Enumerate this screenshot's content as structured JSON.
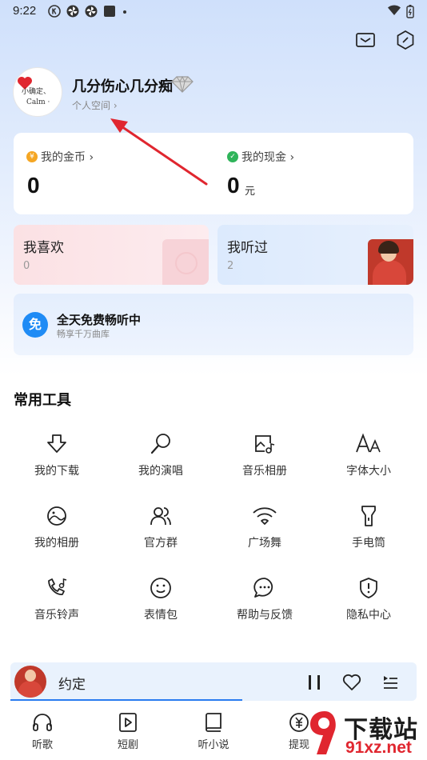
{
  "status_bar": {
    "time": "9:22",
    "left_icons": [
      "k-circle-icon",
      "pinwheel-icon",
      "pinwheel-icon",
      "square-icon",
      "dot-icon"
    ],
    "right_icons": [
      "wifi-icon",
      "battery-icon"
    ]
  },
  "header": {
    "icons": [
      "mail-icon",
      "hexagon-settings-icon"
    ]
  },
  "profile": {
    "username": "几分伤心几分痴",
    "space_link": "个人空间 ›",
    "avatar_text_line1": "小确定、",
    "avatar_text_line2": "Calm ·",
    "badge_icon": "diamond-icon"
  },
  "wallet": {
    "coins_label": "我的金币 ›",
    "coins_value": "0",
    "cash_label": "我的现金 ›",
    "cash_value": "0",
    "cash_unit": "元",
    "coin_icon_glyph": "¥",
    "cash_icon_glyph": "✓"
  },
  "cards": {
    "like_title": "我喜欢",
    "like_count": "0",
    "heard_title": "我听过",
    "heard_count": "2"
  },
  "free_banner": {
    "icon_glyph": "免",
    "title": "全天免费畅听中",
    "subtitle": "畅享千万曲库"
  },
  "tools": {
    "heading": "常用工具",
    "items": [
      {
        "label": "我的下载",
        "icon": "download-icon"
      },
      {
        "label": "我的演唱",
        "icon": "microphone-icon"
      },
      {
        "label": "音乐相册",
        "icon": "music-album-icon"
      },
      {
        "label": "字体大小",
        "icon": "font-size-icon"
      },
      {
        "label": "我的相册",
        "icon": "photo-album-icon"
      },
      {
        "label": "官方群",
        "icon": "group-icon"
      },
      {
        "label": "广场舞",
        "icon": "dance-icon"
      },
      {
        "label": "手电筒",
        "icon": "flashlight-icon"
      },
      {
        "label": "音乐铃声",
        "icon": "ringtone-icon"
      },
      {
        "label": "表情包",
        "icon": "emoji-icon"
      },
      {
        "label": "帮助与反馈",
        "icon": "help-feedback-icon"
      },
      {
        "label": "隐私中心",
        "icon": "privacy-shield-icon"
      }
    ]
  },
  "player": {
    "title": "约定",
    "progress": 0.57,
    "controls": [
      "pause-icon",
      "heart-icon",
      "playlist-icon"
    ]
  },
  "bottom_nav": {
    "items": [
      {
        "label": "听歌",
        "icon": "headphones-icon"
      },
      {
        "label": "短剧",
        "icon": "video-play-icon"
      },
      {
        "label": "听小说",
        "icon": "book-icon"
      },
      {
        "label": "提现",
        "icon": "withdraw-icon"
      }
    ]
  },
  "watermark": {
    "line1": "下载站",
    "line2": "91xz.net"
  },
  "colors": {
    "accent_blue": "#2a7cf0",
    "annotation_red": "#e0262f",
    "coin_orange": "#f5a623",
    "cash_green": "#2fb45a"
  }
}
